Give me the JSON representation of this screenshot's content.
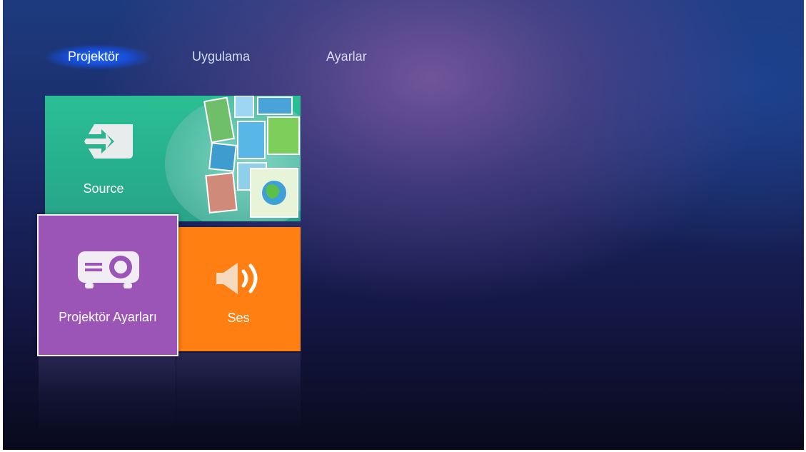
{
  "nav": {
    "tabs": [
      {
        "label": "Projektör",
        "active": true
      },
      {
        "label": "Uygulama",
        "active": false
      },
      {
        "label": "Ayarlar",
        "active": false
      }
    ]
  },
  "tiles": {
    "source": {
      "label": "Source",
      "icon": "source-input-icon",
      "color": "#2bbf94"
    },
    "projector_settings": {
      "label": "Projektör Ayarları",
      "icon": "projector-icon",
      "color": "#9b55b7",
      "focused": true
    },
    "sound": {
      "label": "Ses",
      "icon": "speaker-icon",
      "color": "#ff7f12"
    }
  },
  "colors": {
    "nav_active_glow": "#246eff",
    "background_top": "#1c3b7e",
    "background_bottom": "#090a1c"
  }
}
